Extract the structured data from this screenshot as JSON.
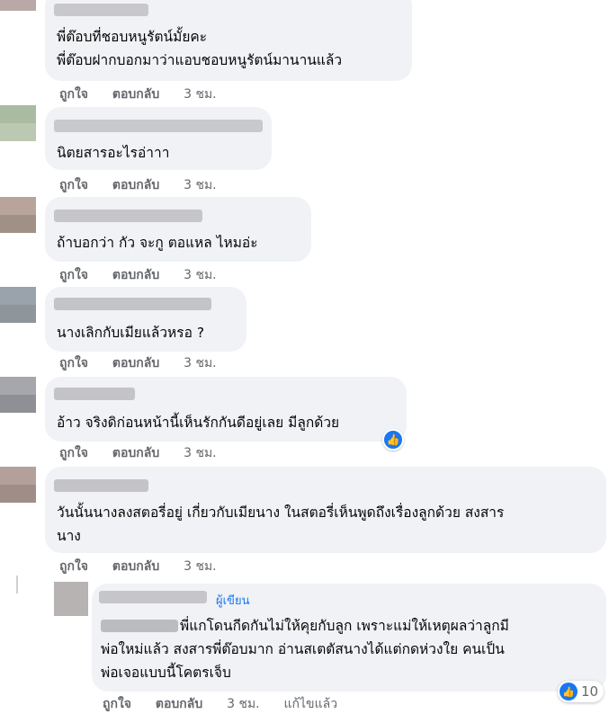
{
  "actions": {
    "like": "ถูกใจ",
    "reply": "ตอบกลับ",
    "edited": "แก้ไขแล้ว"
  },
  "comments": [
    {
      "lines": [
        "พี่ต๊อบที่ชอบหนูรัตน์มั้ยคะ",
        "พี่ต๊อบฝากบอกมาว่าแอบชอบหนูรัตน์มานานแล้ว"
      ],
      "time": "3 ชม."
    },
    {
      "lines": [
        "นิตยสารอะไรอ่าาา"
      ],
      "time": "3 ชม."
    },
    {
      "lines": [
        "ถ้าบอกว่า กัว จะกู ตอแหล ไหมอ่ะ"
      ],
      "time": "3 ชม."
    },
    {
      "lines": [
        "นางเลิกกับเมียแล้วหรอ ?"
      ],
      "time": "3 ชม."
    },
    {
      "lines": [
        "อ้าว จริงดิก่อนหน้านี้เห็นรักกันดีอยู่เลย มีลูกด้วย"
      ],
      "time": "3 ชม."
    },
    {
      "lines": [
        "วันนั้นนางลงสตอรี่อยู่ เกี่ยวกับเมียนาง ในสตอรี่เห็นพูดถึงเรื่องลูกด้วย สงสาร",
        "นาง"
      ],
      "time": "3 ชม."
    }
  ],
  "reply": {
    "author_badge": "ผู้เขียน",
    "lines": [
      "พี่แกโดนกีดกันไม่ให้คุยกับลูก เพราะแม่ให้เหตุผลว่าลูกมี",
      "พ่อใหม่แล้ว สงสารพี่ต๊อบมาก อ่านสเตตัสนางได้แต่กดห่วงใย คนเป็น",
      "พ่อเจอแบบนี้โคตรเจ็บ"
    ],
    "time": "3 ชม.",
    "reaction_count": "10"
  },
  "colors": {
    "bubble": "#f0f2f5",
    "meta_text": "#65676b",
    "like_blue": "#1877f2"
  }
}
